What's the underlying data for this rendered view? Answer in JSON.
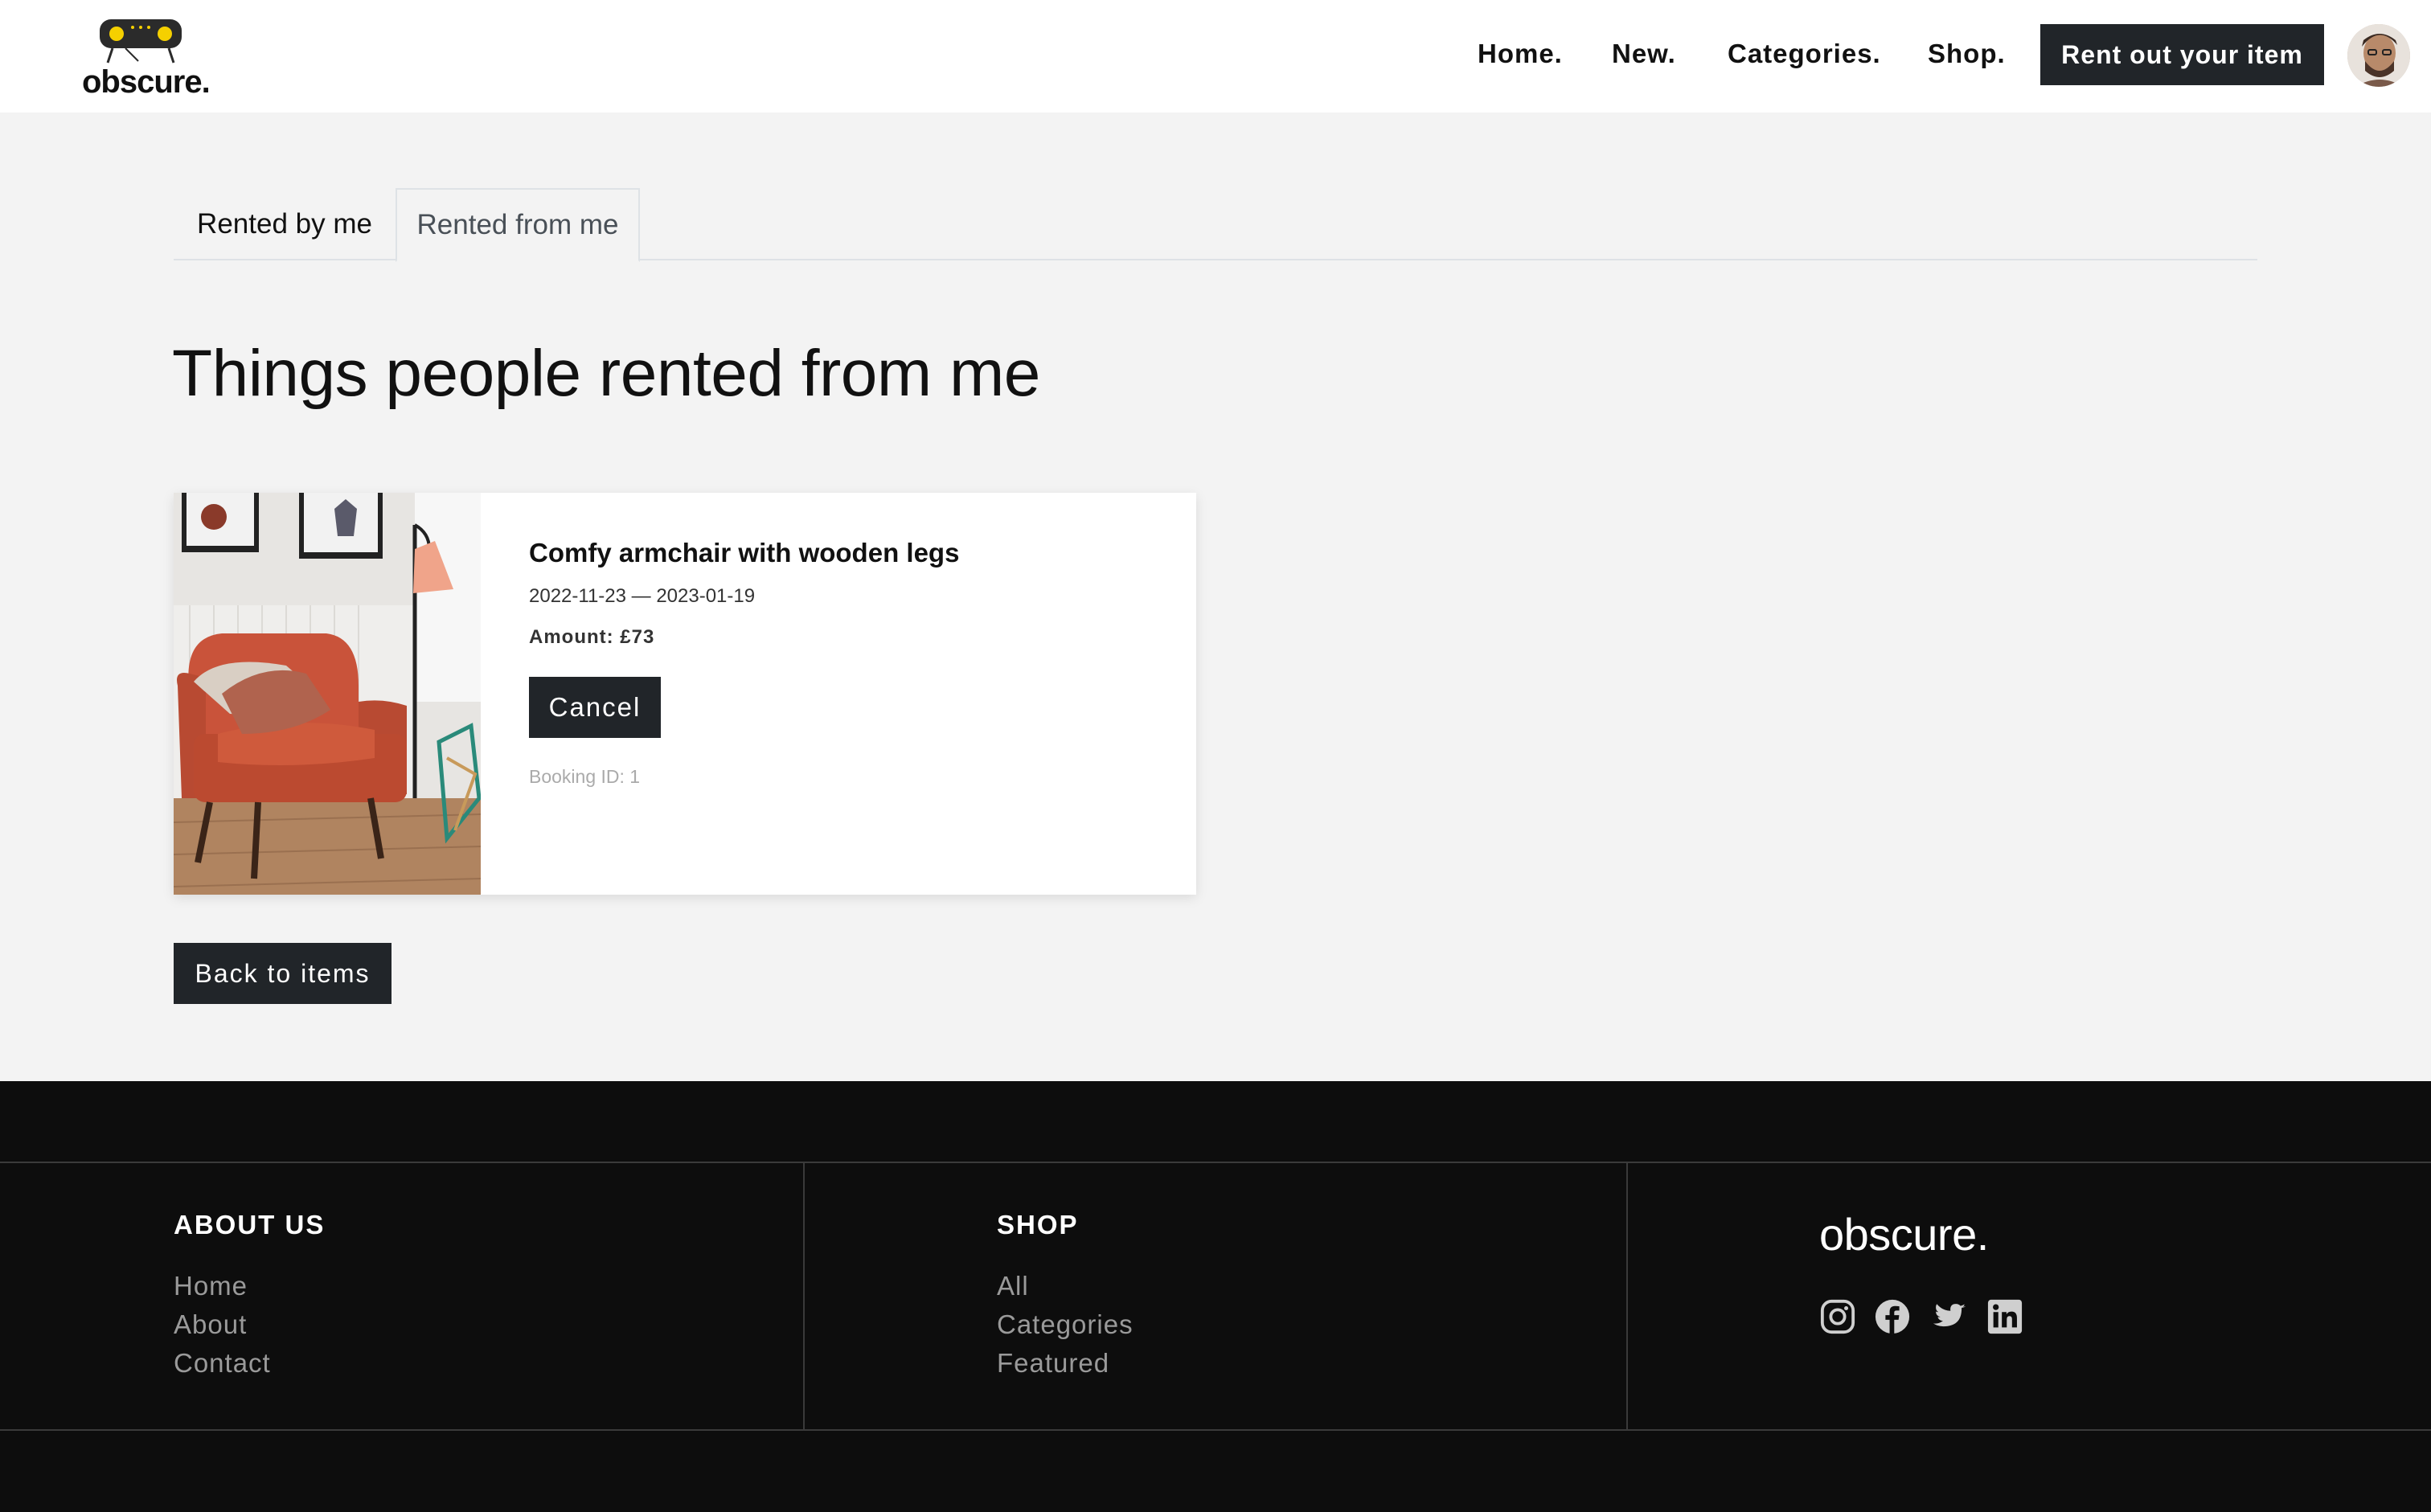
{
  "header": {
    "logo_text": "obscure.",
    "nav": [
      "Home.",
      "New.",
      "Categories.",
      "Shop."
    ],
    "rent_button": "Rent out your item"
  },
  "tabs": [
    {
      "label": "Rented by me",
      "active": false
    },
    {
      "label": "Rented from me",
      "active": true
    }
  ],
  "page_title": "Things people rented from me",
  "booking": {
    "title": "Comfy armchair with wooden legs",
    "dates": "2022-11-23 — 2023-01-19",
    "amount": "Amount: £73",
    "cancel_label": "Cancel",
    "booking_id": "Booking ID: 1"
  },
  "back_button": "Back to items",
  "footer": {
    "about": {
      "heading": "ABOUT US",
      "links": [
        "Home",
        "About",
        "Contact"
      ]
    },
    "shop": {
      "heading": "SHOP",
      "links": [
        "All",
        "Categories",
        "Featured"
      ]
    },
    "brand": "obscure.",
    "social": [
      "instagram-icon",
      "facebook-icon",
      "twitter-icon",
      "linkedin-icon"
    ]
  },
  "colors": {
    "dark": "#212529",
    "page_bg": "#f3f3f3",
    "footer_bg": "#0d0d0d",
    "logo_accent": "#f5d000"
  }
}
